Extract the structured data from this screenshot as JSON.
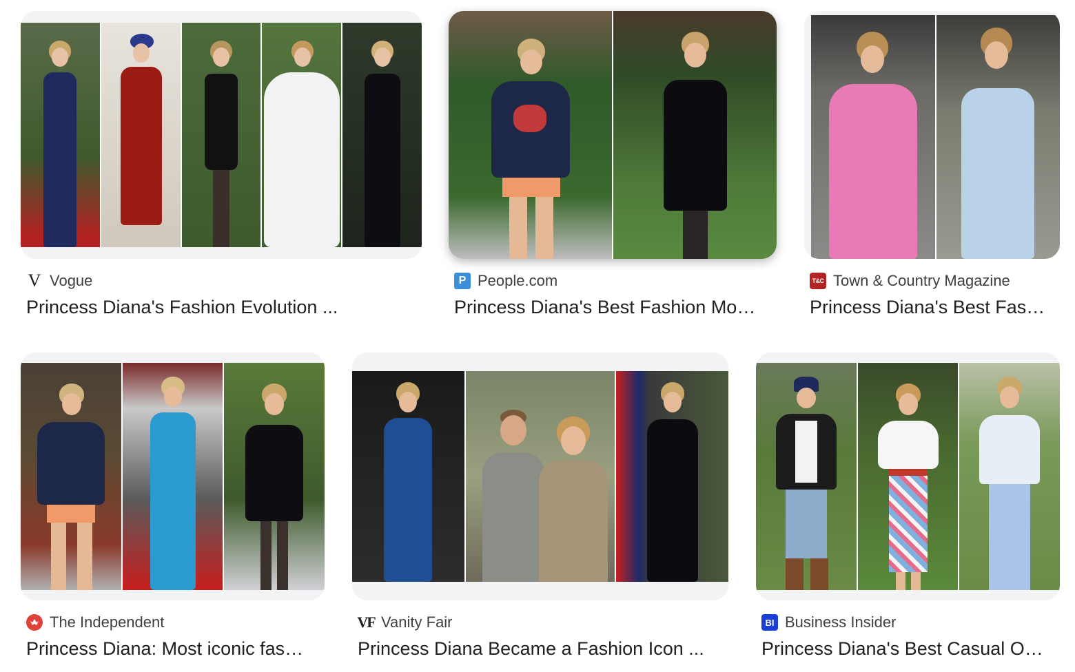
{
  "results": [
    {
      "source": "Vogue",
      "title": "Princess Diana's Fashion Evolution ...",
      "favicon": "V"
    },
    {
      "source": "People.com",
      "title": "Princess Diana's Best Fashion Mo…",
      "favicon": "P"
    },
    {
      "source": "Town & Country Magazine",
      "title": "Princess Diana's Best Fas…",
      "favicon": "T&C"
    },
    {
      "source": "The Independent",
      "title": "Princess Diana: Most iconic fas…",
      "favicon": ""
    },
    {
      "source": "Vanity Fair",
      "title": "Princess Diana Became a Fashion Icon ...",
      "favicon": "VF"
    },
    {
      "source": "Business Insider",
      "title": "Princess Diana's Best Casual O…",
      "favicon": "BI"
    }
  ]
}
